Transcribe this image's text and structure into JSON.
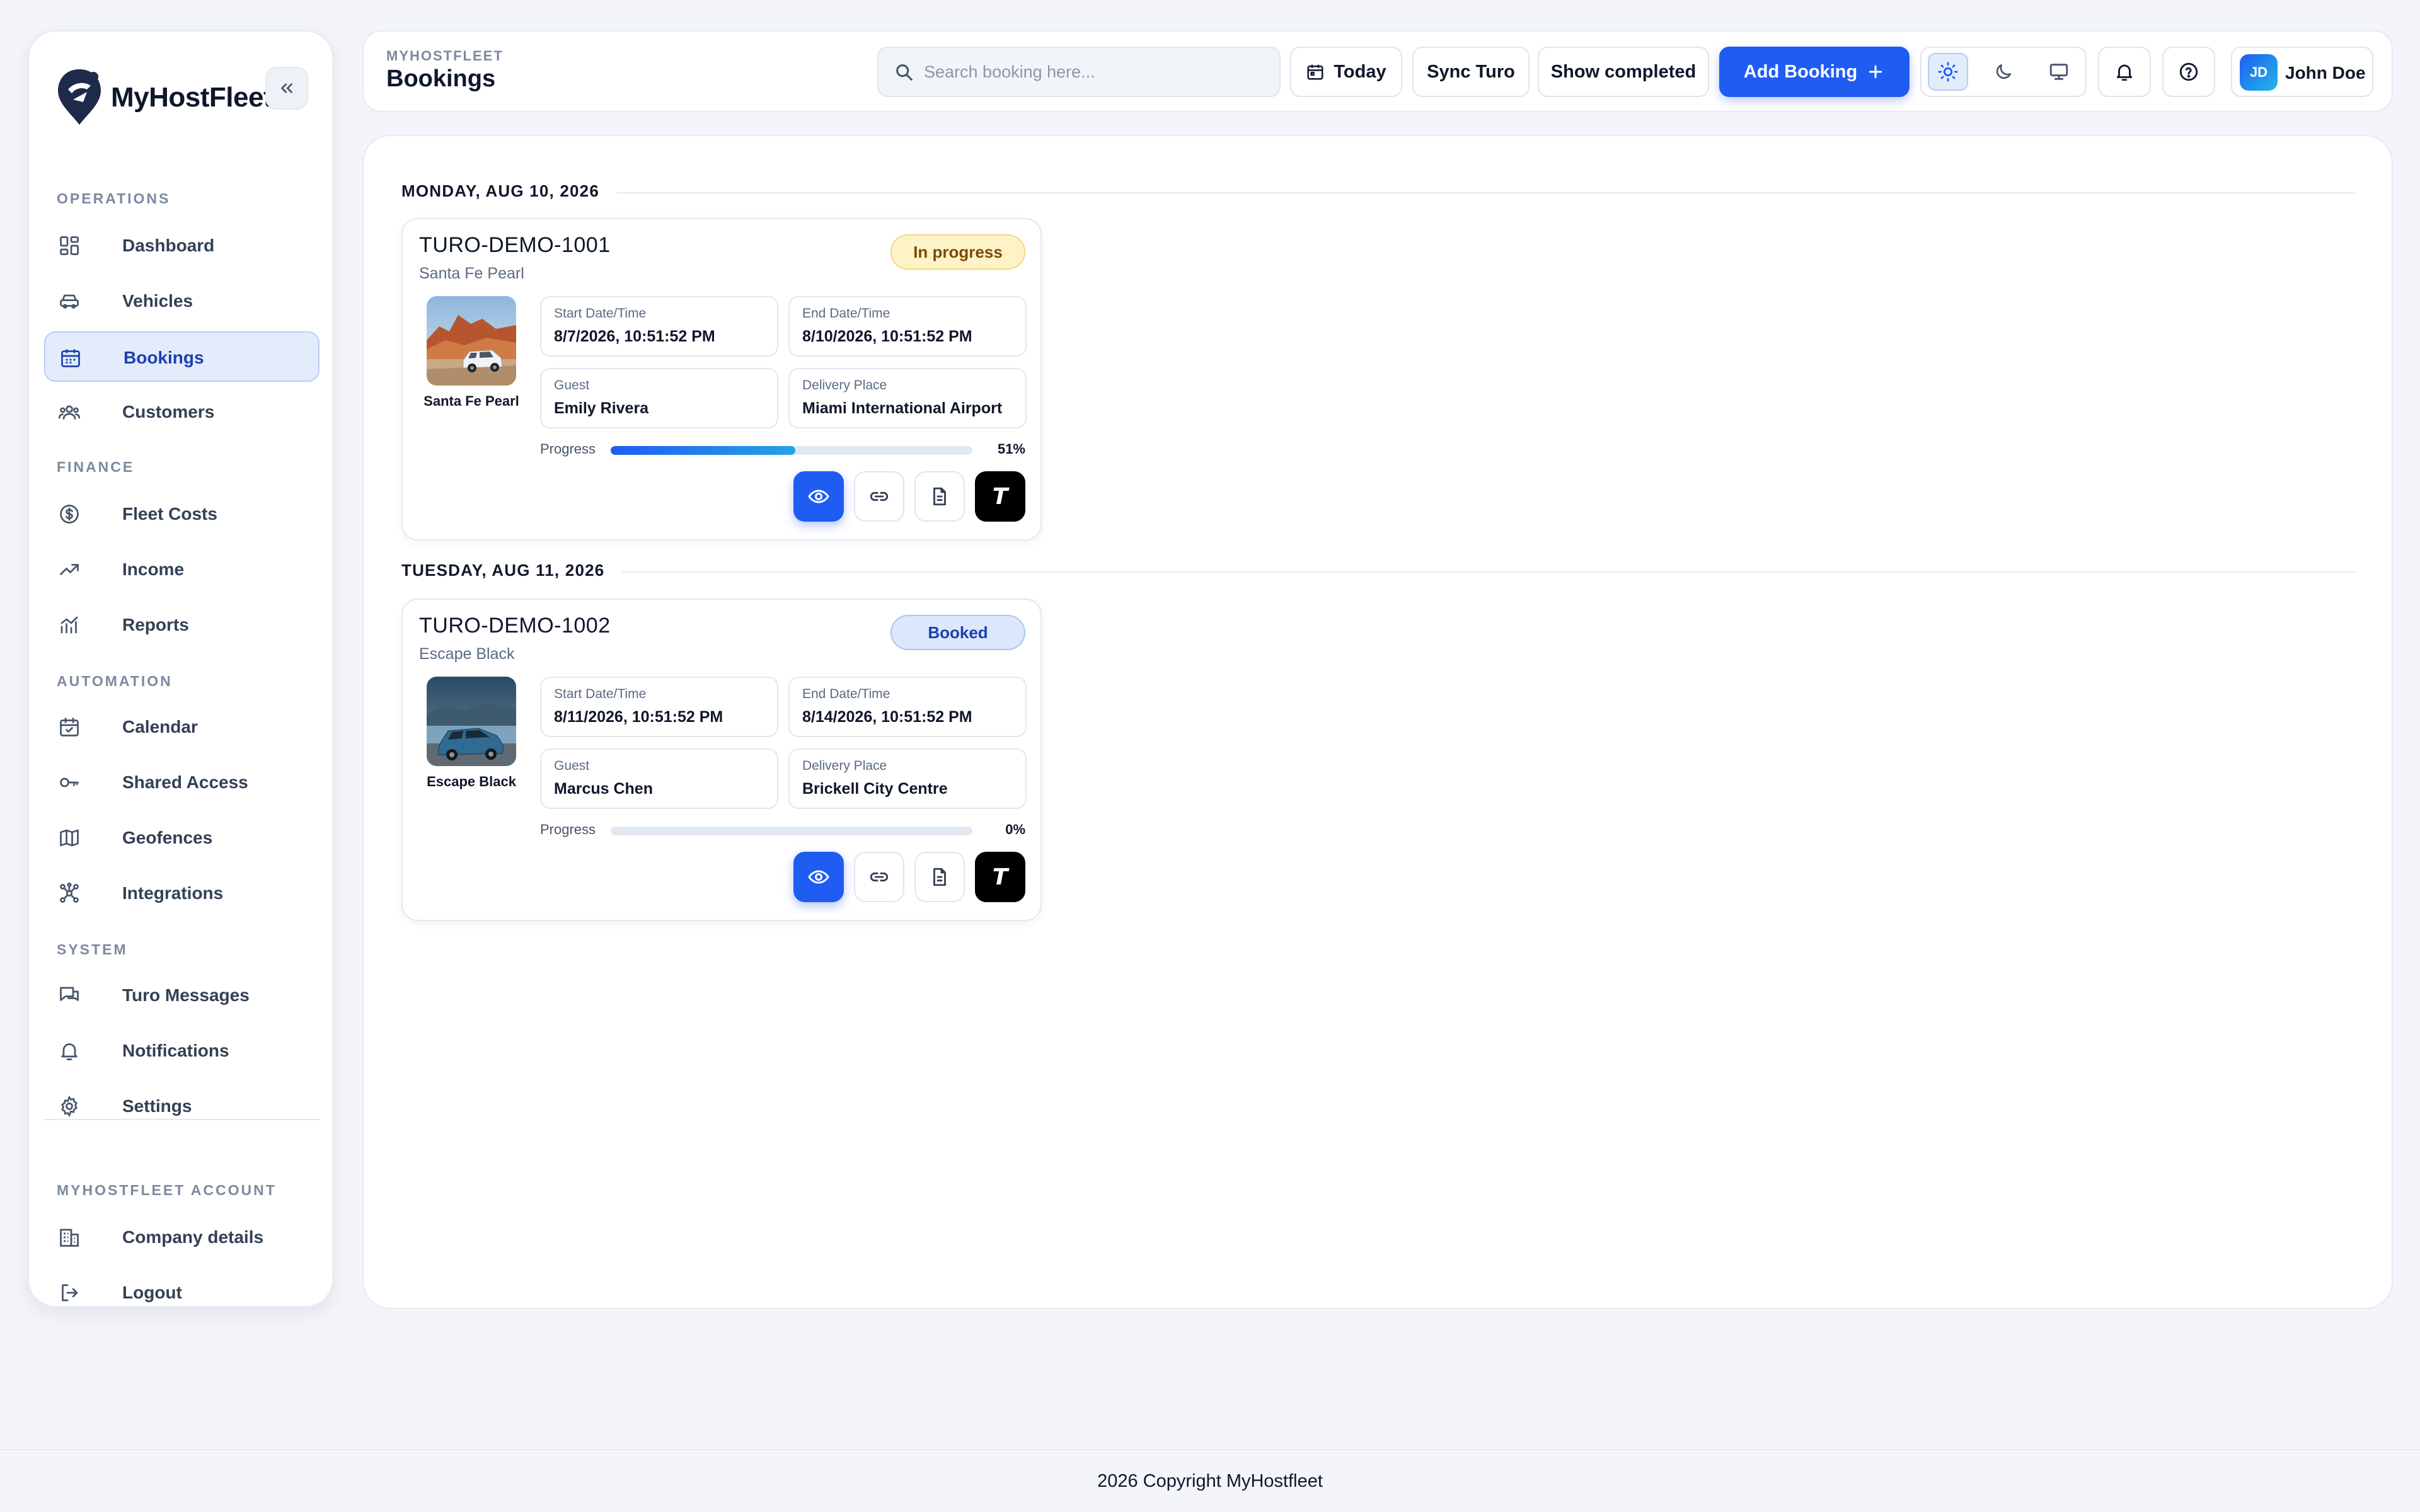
{
  "app": {
    "brand": "MyHostFleet"
  },
  "sidebar": {
    "sections": {
      "operations": "OPERATIONS",
      "finance": "FINANCE",
      "automation": "AUTOMATION",
      "system": "SYSTEM",
      "account": "MYHOSTFLEET ACCOUNT"
    },
    "items": {
      "dashboard": "Dashboard",
      "vehicles": "Vehicles",
      "bookings": "Bookings",
      "customers": "Customers",
      "fleet_costs": "Fleet Costs",
      "income": "Income",
      "reports": "Reports",
      "calendar": "Calendar",
      "shared_access": "Shared Access",
      "geofences": "Geofences",
      "integrations": "Integrations",
      "turo_messages": "Turo Messages",
      "notifications": "Notifications",
      "settings": "Settings",
      "company_details": "Company details",
      "logout": "Logout"
    },
    "active_item": "bookings"
  },
  "header": {
    "kicker": "MYHOSTFLEET",
    "title": "Bookings",
    "search_placeholder": "Search booking here...",
    "search_value": "",
    "today_label": "Today",
    "sync_label": "Sync Turo",
    "show_completed_label": "Show completed",
    "add_booking_label": "Add Booking",
    "theme_selected": "light",
    "user": {
      "initials": "JD",
      "name": "John Doe"
    }
  },
  "bookings": {
    "progress_label": "Progress",
    "field_labels": {
      "start": "Start Date/Time",
      "end": "End Date/Time",
      "guest": "Guest",
      "delivery": "Delivery Place"
    },
    "days": [
      {
        "date_label": "MONDAY, AUG 10, 2026",
        "booking": {
          "ref": "TURO-DEMO-1001",
          "vehicle": "Santa Fe Pearl",
          "status": "In progress",
          "start": "8/7/2026, 10:51:52 PM",
          "end": "8/10/2026, 10:51:52 PM",
          "guest": "Emily Rivera",
          "delivery": "Miami International Airport",
          "progress": 0.51,
          "progress_text": "51%"
        }
      },
      {
        "date_label": "TUESDAY, AUG 11, 2026",
        "booking": {
          "ref": "TURO-DEMO-1002",
          "vehicle": "Escape Black",
          "status": "Booked",
          "start": "8/11/2026, 10:51:52 PM",
          "end": "8/14/2026, 10:51:52 PM",
          "guest": "Marcus Chen",
          "delivery": "Brickell City Centre",
          "progress": 0,
          "progress_text": "0%"
        }
      }
    ]
  },
  "footer": {
    "text": "2026 Copyright MyHostfleet"
  },
  "colors": {
    "accent": "#1f5cf2",
    "in_progress_badge": "#fdf3c7",
    "booked_badge": "#dbe8fb"
  },
  "icons": {
    "collapse": "chevrons-left-icon",
    "search": "search-icon",
    "today": "calendar-icon",
    "add": "plus-icon",
    "theme_light": "sun-icon",
    "theme_dark": "moon-icon",
    "theme_system": "monitor-icon",
    "notifications": "bell-icon",
    "help": "help-circle-icon",
    "view": "eye-icon",
    "link": "link-icon",
    "document": "document-icon",
    "turo": "turo-logo-icon"
  }
}
